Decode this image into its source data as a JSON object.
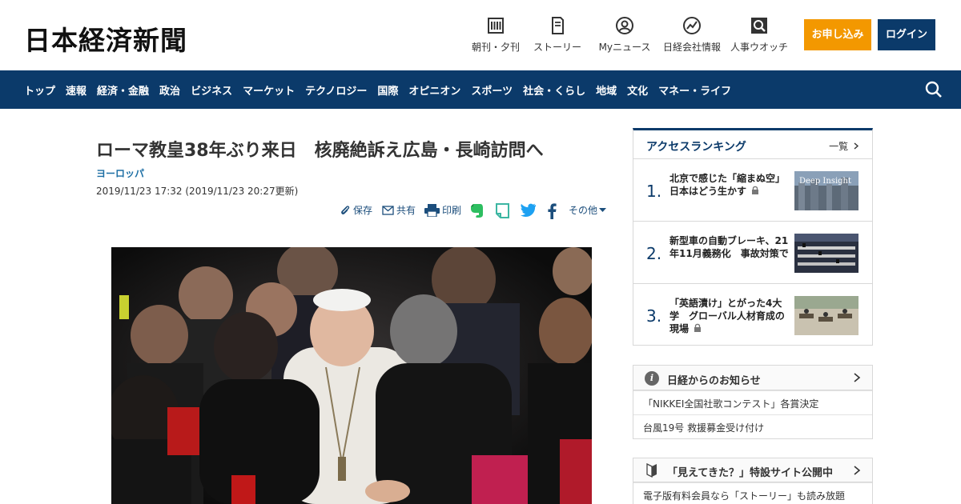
{
  "header": {
    "logo": "日本経済新聞",
    "items": [
      {
        "label": "朝刊・夕刊",
        "icon": "newspaper-icon"
      },
      {
        "label": "ストーリー",
        "icon": "story-icon"
      },
      {
        "label": "Myニュース",
        "icon": "user-icon"
      },
      {
        "label": "日経会社情報",
        "icon": "chart-icon"
      },
      {
        "label": "人事ウオッチ",
        "icon": "search-person-icon"
      }
    ],
    "apply_label": "お申し込み",
    "login_label": "ログイン",
    "apply_color": "#f39800",
    "brand_color": "#0b3a6a"
  },
  "nav": {
    "items": [
      "トップ",
      "速報",
      "経済・金融",
      "政治",
      "ビジネス",
      "マーケット",
      "テクノロジー",
      "国際",
      "オピニオン",
      "スポーツ",
      "社会・くらし",
      "地域",
      "文化",
      "マネー・ライフ"
    ]
  },
  "article": {
    "title": "ローマ教皇38年ぶり来日　核廃絶訴え広島・長崎訪問へ",
    "category": "ヨーロッパ",
    "date": "2019/11/23 17:32 (2019/11/23 20:27更新)",
    "share": {
      "save": "保存",
      "share": "共有",
      "print": "印刷",
      "other": "その他"
    }
  },
  "sidebar": {
    "ranking": {
      "title": "アクセスランキング",
      "more": "一覧",
      "items": [
        {
          "rank": "1.",
          "text": "北京で感じた「縮まぬ空」　日本はどう生かす",
          "thumb_text": "Deep Insight"
        },
        {
          "rank": "2.",
          "text": "新型車の自動ブレーキ、21年11月義務化　事故対策で",
          "thumb_text": ""
        },
        {
          "rank": "3.",
          "text": "「英語漬け」とがった4大学　グローバル人材育成の現場",
          "thumb_text": ""
        }
      ]
    },
    "notice": {
      "title": "日経からのお知らせ",
      "items": [
        "「NIKKEI全国社歌コンテスト」各賞決定",
        "台風19号 救援募金受け付け"
      ]
    },
    "feature": {
      "title": "「見えてきた？」特設サイト公開中",
      "text": "電子版有料会員なら「ストーリー」も読み放題"
    }
  }
}
